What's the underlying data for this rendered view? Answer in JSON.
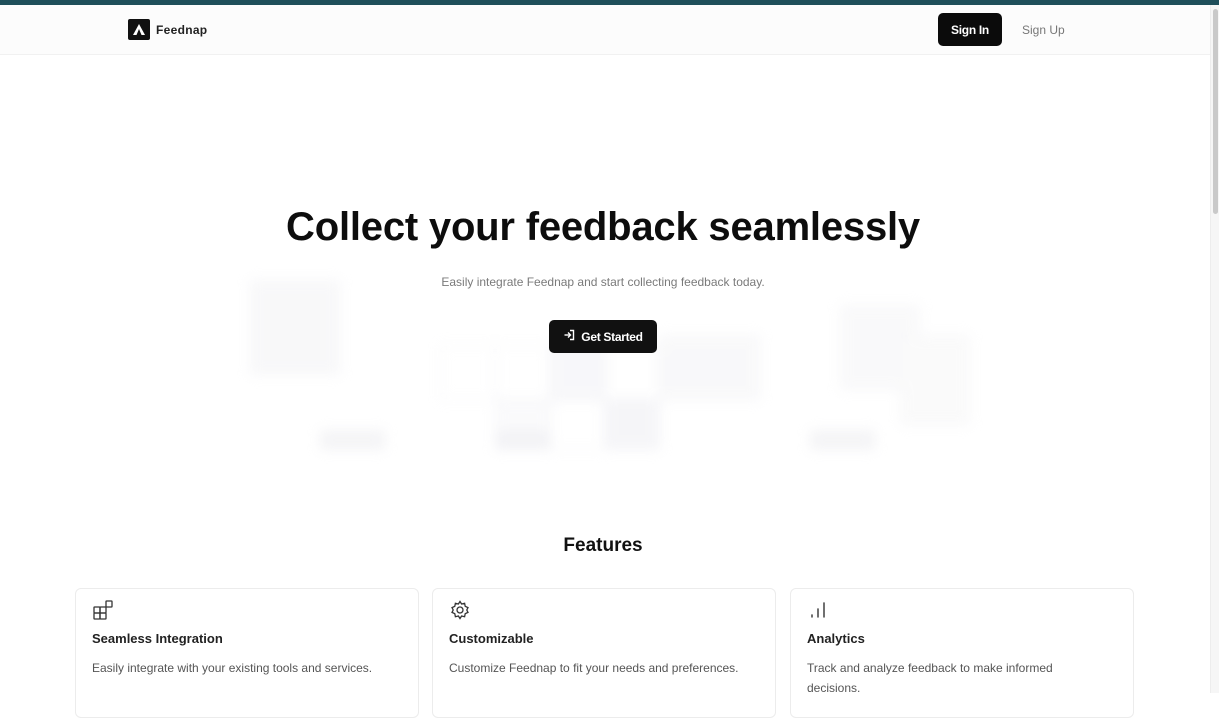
{
  "header": {
    "brand_name": "Feednap",
    "signin_label": "Sign In",
    "signup_label": "Sign Up",
    "logo_icon": "feednap-logo-icon"
  },
  "hero": {
    "title": "Collect your feedback seamlessly",
    "subtitle": "Easily integrate Feednap and start collecting feedback today.",
    "cta_label": "Get Started",
    "cta_icon": "login-arrow-icon"
  },
  "features": {
    "title": "Features",
    "items": [
      {
        "title": "Seamless Integration",
        "description": "Easily integrate with your existing tools and services.",
        "icon": "blocks-icon"
      },
      {
        "title": "Customizable",
        "description": "Customize Feednap to fit your needs and preferences.",
        "icon": "gear-icon"
      },
      {
        "title": "Analytics",
        "description": "Track and analyze feedback to make informed decisions.",
        "icon": "bar-chart-icon"
      }
    ]
  },
  "colors": {
    "top_strip": "#1f4f5a",
    "primary_button": "#111111",
    "muted_text": "#7a7a7a"
  }
}
